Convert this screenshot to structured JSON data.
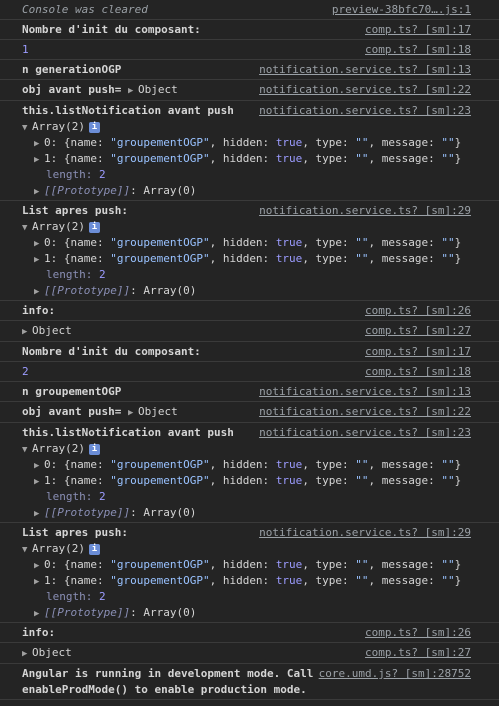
{
  "rows": {
    "cleared": {
      "text": "Console was cleared",
      "src": "preview-38bfc70….js:1"
    },
    "r1": {
      "text": "Nombre d'init du composant:",
      "src": "comp.ts? [sm]:17"
    },
    "r2": {
      "text": "1",
      "src": "comp.ts? [sm]:18"
    },
    "r3": {
      "text": "n generationOGP",
      "src": "notification.service.ts? [sm]:13"
    },
    "r4": {
      "text": "obj avant push=",
      "obj": "Object",
      "src": "notification.service.ts? [sm]:22"
    },
    "r5": {
      "text": "this.listNotification  avant push",
      "src": "notification.service.ts? [sm]:23"
    },
    "r6": {
      "text": "List apres push:",
      "src": "notification.service.ts? [sm]:29"
    },
    "r7": {
      "text": "info:",
      "src": "comp.ts? [sm]:26"
    },
    "r8": {
      "obj": "Object",
      "src": "comp.ts? [sm]:27"
    },
    "r9": {
      "text": "Nombre d'init du composant:",
      "src": "comp.ts? [sm]:17"
    },
    "r10": {
      "text": "2",
      "src": "comp.ts? [sm]:18"
    },
    "r11": {
      "text": "n groupementOGP",
      "src": "notification.service.ts? [sm]:13"
    },
    "r12": {
      "text": "obj avant push=",
      "obj": "Object",
      "src": "notification.service.ts? [sm]:22"
    },
    "r13": {
      "text": "this.listNotification  avant push",
      "src": "notification.service.ts? [sm]:23"
    },
    "r14": {
      "text": "List apres push:",
      "src": "notification.service.ts? [sm]:29"
    },
    "r15": {
      "text": "info:",
      "src": "comp.ts? [sm]:26"
    },
    "r16": {
      "obj": "Object",
      "src": "comp.ts? [sm]:27"
    },
    "r17": {
      "text1": "Angular is running in development mode. Call",
      "text2": "enableProdMode() to enable production mode.",
      "src": "core.umd.js? [sm]:28752"
    }
  },
  "array": {
    "header": "Array(2)",
    "badge": "i",
    "i0": "0:",
    "i1": "1:",
    "open": "{name: ",
    "name_val": "\"groupementOGP\"",
    "hidden_key": ", hidden: ",
    "hidden_val": "true",
    "type_key": ", type: ",
    "type_val": "\"\"",
    "msg_key": ", message: ",
    "msg_val": "\"\"",
    "close": "}",
    "length_key": "length:",
    "length_val": "2",
    "proto_key": "[[Prototype]]",
    "proto_val": ": Array(0)"
  }
}
